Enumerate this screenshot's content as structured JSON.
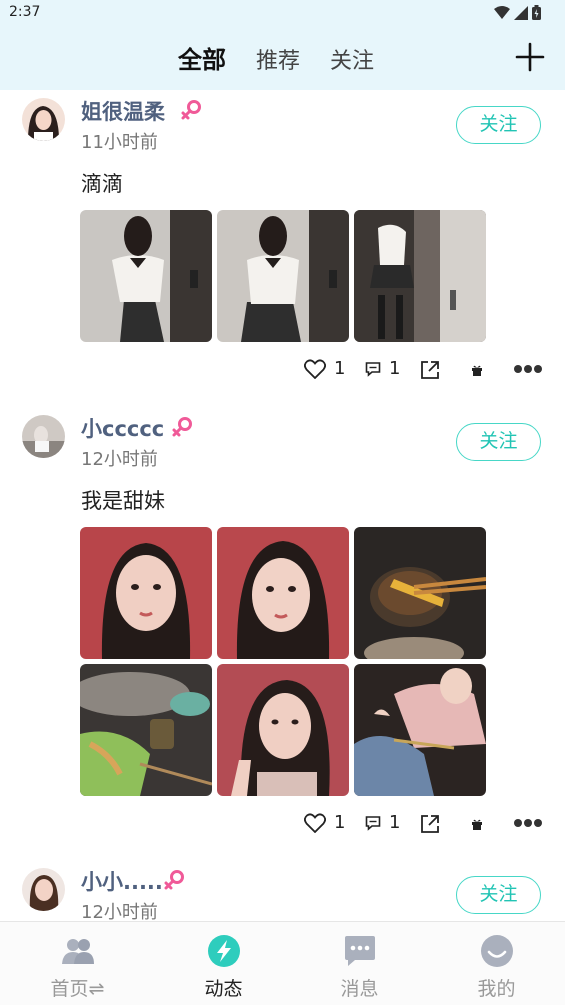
{
  "status_bar": {
    "time": "2:37"
  },
  "header": {
    "tabs": [
      {
        "label": "全部",
        "active": true
      },
      {
        "label": "推荐",
        "active": false
      },
      {
        "label": "关注",
        "active": false
      }
    ],
    "add_icon": "plus-icon"
  },
  "posts": [
    {
      "username": "姐很温柔",
      "gender_icon": "female-icon",
      "time": "11小时前",
      "follow_label": "关注",
      "content": "滴滴",
      "likes": "1",
      "comments": "1"
    },
    {
      "username": "小ccccc",
      "gender_icon": "female-icon",
      "time": "12小时前",
      "follow_label": "关注",
      "content": "我是甜妹",
      "likes": "1",
      "comments": "1"
    },
    {
      "username": "小小.....",
      "gender_icon": "female-icon",
      "time": "12小时前",
      "follow_label": "关注"
    }
  ],
  "bottom_nav": [
    {
      "label": "首页⇌",
      "icon": "users-icon",
      "active": false
    },
    {
      "label": "动态",
      "icon": "lightning-icon",
      "active": true
    },
    {
      "label": "消息",
      "icon": "chat-icon",
      "active": false
    },
    {
      "label": "我的",
      "icon": "smile-icon",
      "active": false
    }
  ],
  "colors": {
    "header_bg": "#e7f6fb",
    "accent": "#22c4b4",
    "username": "#50617f",
    "gender": "#f05a98"
  }
}
